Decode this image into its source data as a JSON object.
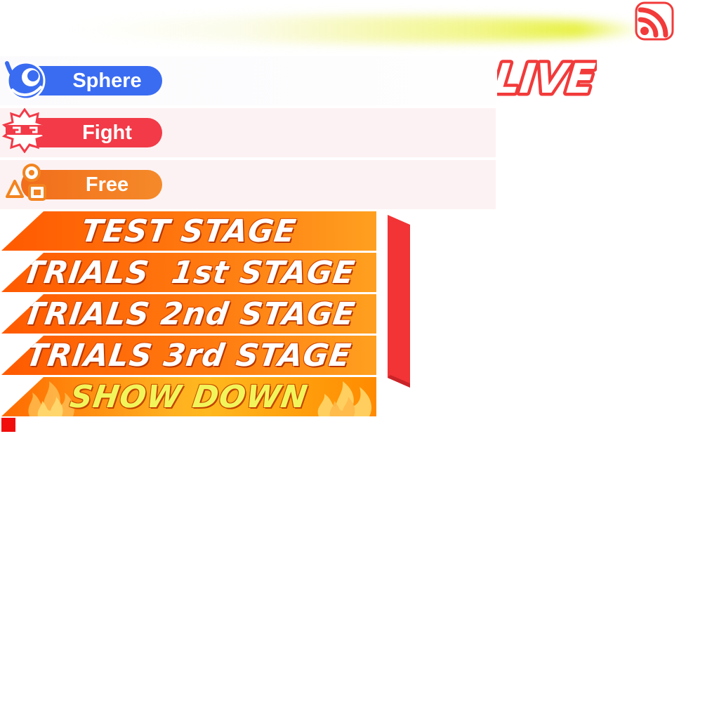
{
  "header": {
    "live_label": "LIVE",
    "feed_icon": "rss-feed-icon"
  },
  "modes": [
    {
      "label": "Sphere",
      "icon": "sphere-swirl-icon",
      "color": "#3a6cf2"
    },
    {
      "label": "Fight",
      "icon": "fight-mask-icon",
      "color": "#f23a48"
    },
    {
      "label": "Free",
      "icon": "free-shapes-icon",
      "color": "#f28420"
    }
  ],
  "stages": [
    {
      "label": "TEST STAGE"
    },
    {
      "label": "TRIALS  1st STAGE"
    },
    {
      "label": "TRIALS 2nd STAGE"
    },
    {
      "label": "TRIALS 3rd STAGE"
    },
    {
      "label": "SHOW DOWN",
      "icon": "flame-icon"
    }
  ],
  "colors": {
    "accent_red": "#f23a3a",
    "stage_orange": "#ff7a10",
    "showdown_text": "#f2f55a"
  }
}
